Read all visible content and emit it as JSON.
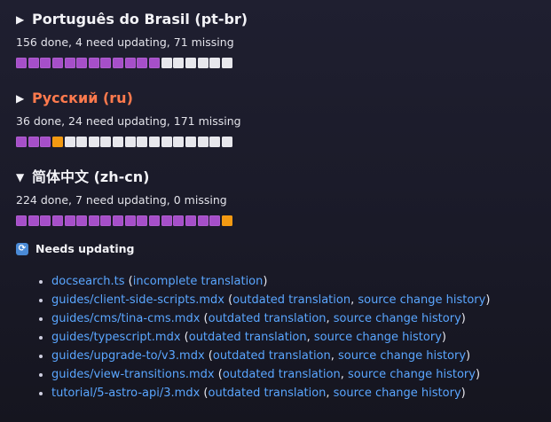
{
  "sections": [
    {
      "title": "Português do Brasil (pt-br)",
      "toggle": "▶",
      "stats": "156 done, 4 need updating, 71 missing",
      "progress": {
        "done": 12,
        "updating": 0,
        "missing": 6
      }
    },
    {
      "title": "Русский (ru)",
      "toggle": "▶",
      "stats": "36 done, 24 need updating, 171 missing",
      "progress": {
        "done": 3,
        "updating": 1,
        "missing": 14
      }
    },
    {
      "title": "简体中文 (zh-cn)",
      "toggle": "▼",
      "stats": "224 done, 7 need updating, 0 missing",
      "progress": {
        "done": 17,
        "updating": 1,
        "missing": 0
      }
    }
  ],
  "needs_updating": {
    "icon": "refresh-icon",
    "label": "Needs updating",
    "items": [
      {
        "file": "docsearch.ts",
        "links": [
          "incomplete translation"
        ]
      },
      {
        "file": "guides/client-side-scripts.mdx",
        "links": [
          "outdated translation",
          "source change history"
        ]
      },
      {
        "file": "guides/cms/tina-cms.mdx",
        "links": [
          "outdated translation",
          "source change history"
        ]
      },
      {
        "file": "guides/typescript.mdx",
        "links": [
          "outdated translation",
          "source change history"
        ]
      },
      {
        "file": "guides/upgrade-to/v3.mdx",
        "links": [
          "outdated translation",
          "source change history"
        ]
      },
      {
        "file": "guides/view-transitions.mdx",
        "links": [
          "outdated translation",
          "source change history"
        ]
      },
      {
        "file": "tutorial/5-astro-api/3.mdx",
        "links": [
          "outdated translation",
          "source change history"
        ]
      }
    ]
  },
  "colors": {
    "done": "#a64fc9",
    "updating": "#f39a12",
    "missing": "#e7e7ec",
    "link": "#5aa6ff",
    "accent_title": "#ff7a4d"
  }
}
